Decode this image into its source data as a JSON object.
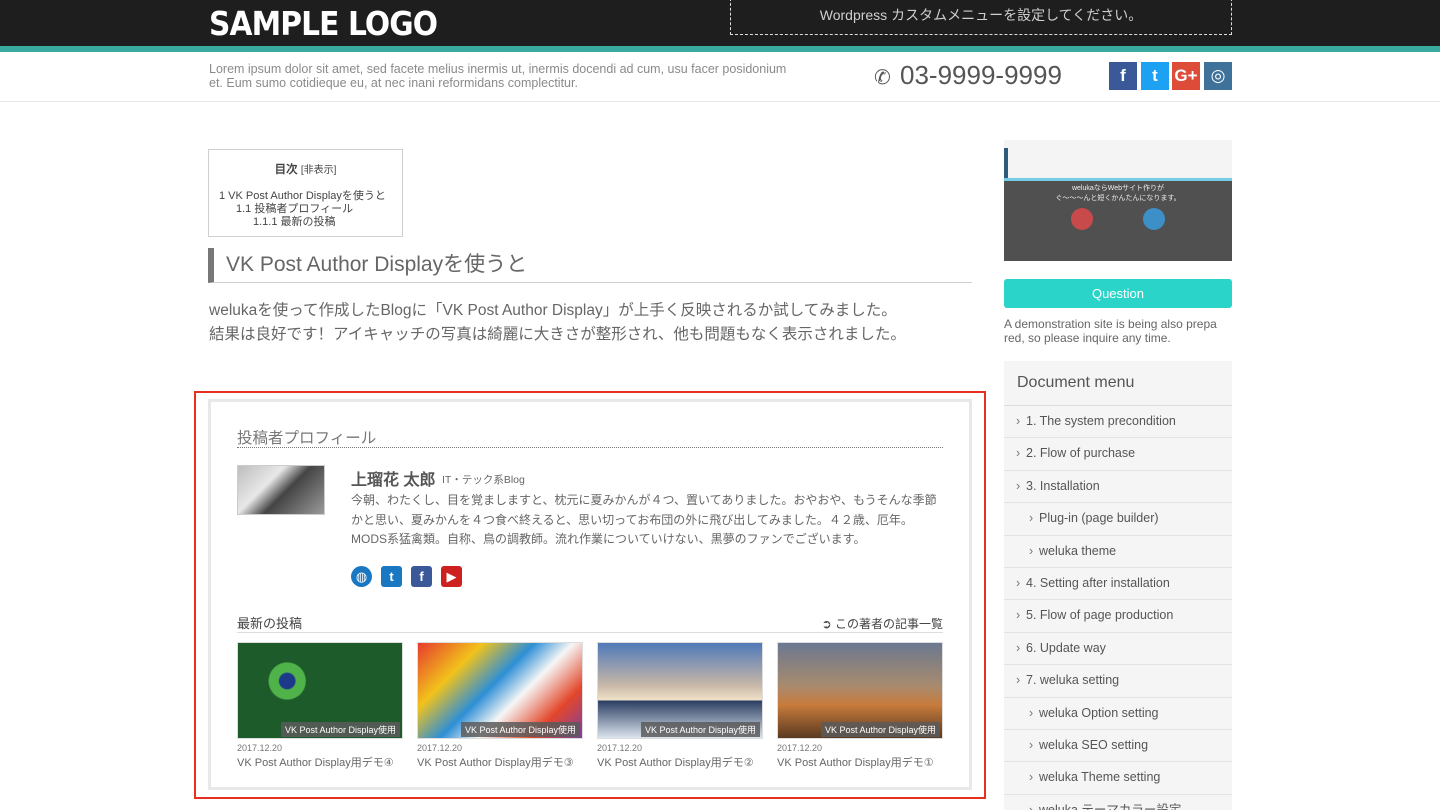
{
  "header": {
    "logo": "SAMPLE LOGO",
    "custom_menu_placeholder": "Wordpress カスタムメニューを設定してください。",
    "tagline": "Lorem ipsum dolor sit amet, sed facete melius inermis ut, inermis docendi ad cum, usu facer posidonium et. Eum sumo cotidieque eu, at nec inani reformidans complectitur.",
    "phone": "03-9999-9999",
    "social": [
      {
        "icon": "facebook-icon",
        "glyph": "f",
        "color": "#3b5998"
      },
      {
        "icon": "twitter-icon",
        "glyph": "t",
        "color": "#1da1f2"
      },
      {
        "icon": "googleplus-icon",
        "glyph": "G+",
        "color": "#dd4b39"
      },
      {
        "icon": "instagram-icon",
        "glyph": "◎",
        "color": "#3f729b"
      }
    ]
  },
  "toc": {
    "title": "目次",
    "toggle": "[非表示]",
    "items": [
      "1 VK Post Author Displayを使うと",
      "1.1 投稿者プロフィール",
      "1.1.1 最新の投稿"
    ]
  },
  "article": {
    "heading": "VK Post Author Displayを使うと",
    "paragraph_line1": "welukaを使って作成したBlogに「VK Post Author Display」が上手く反映されるか試してみました。",
    "paragraph_line2": "結果は良好です！アイキャッチの写真は綺麗に大きさが整形され、他も問題もなく表示されました。"
  },
  "author_box": {
    "title": "投稿者プロフィール",
    "name": "上瑠花 太郎",
    "subtitle": "IT・テック系Blog",
    "bio": "今朝、わたくし、目を覚ましますと、枕元に夏みかんが４つ、置いてありました。おやおや、もうそんな季節かと思い、夏みかんを４つ食べ終えると、思い切ってお布団の外に飛び出してみました。４２歳、厄年。MODS系猛禽類。自称、鳥の調教師。流れ作業についていけない、黒夢のファンでございます。",
    "icons": [
      {
        "name": "globe-icon",
        "glyph": "◍",
        "color": "#1a78c2"
      },
      {
        "name": "twitter-icon",
        "glyph": "t",
        "color": "#1a78c2"
      },
      {
        "name": "facebook-icon",
        "glyph": "f",
        "color": "#3b5998"
      },
      {
        "name": "youtube-icon",
        "glyph": "▶",
        "color": "#cd201f"
      }
    ],
    "recent_title": "最新の投稿",
    "more_link": "この著者の記事一覧",
    "posts": [
      {
        "badge": "VK Post Author Display使用",
        "date": "2017.12.20",
        "title": "VK Post Author Display用デモ④",
        "thumb": "peacock"
      },
      {
        "badge": "VK Post Author Display使用",
        "date": "2017.12.20",
        "title": "VK Post Author Display用デモ③",
        "thumb": "paint"
      },
      {
        "badge": "VK Post Author Display使用",
        "date": "2017.12.20",
        "title": "VK Post Author Display用デモ②",
        "thumb": "snow"
      },
      {
        "badge": "VK Post Author Display使用",
        "date": "2017.12.20",
        "title": "VK Post Author Display用デモ①",
        "thumb": "elephant"
      }
    ]
  },
  "sidebar": {
    "image_text_line1": "welukaならWebサイト作りが",
    "image_text_line2": "ぐ〜〜〜んと短くかんたんになります。",
    "question_button": "Question",
    "note": "A demonstration site is being also prepa red, so please inquire any time.",
    "menu_title": "Document menu",
    "menu_items": [
      {
        "label": "1. The system precondition",
        "sub": false
      },
      {
        "label": "2. Flow of purchase",
        "sub": false
      },
      {
        "label": "3. Installation",
        "sub": false
      },
      {
        "label": "Plug-in (page builder)",
        "sub": true
      },
      {
        "label": "weluka theme",
        "sub": true
      },
      {
        "label": "4. Setting after installation",
        "sub": false
      },
      {
        "label": "5. Flow of page production",
        "sub": false
      },
      {
        "label": "6. Update way",
        "sub": false
      },
      {
        "label": "7. weluka setting",
        "sub": false
      },
      {
        "label": "weluka Option setting",
        "sub": true
      },
      {
        "label": "weluka SEO setting",
        "sub": true
      },
      {
        "label": "weluka Theme setting",
        "sub": true
      },
      {
        "label": "weluka テーマカラー設定",
        "sub": true
      }
    ]
  }
}
